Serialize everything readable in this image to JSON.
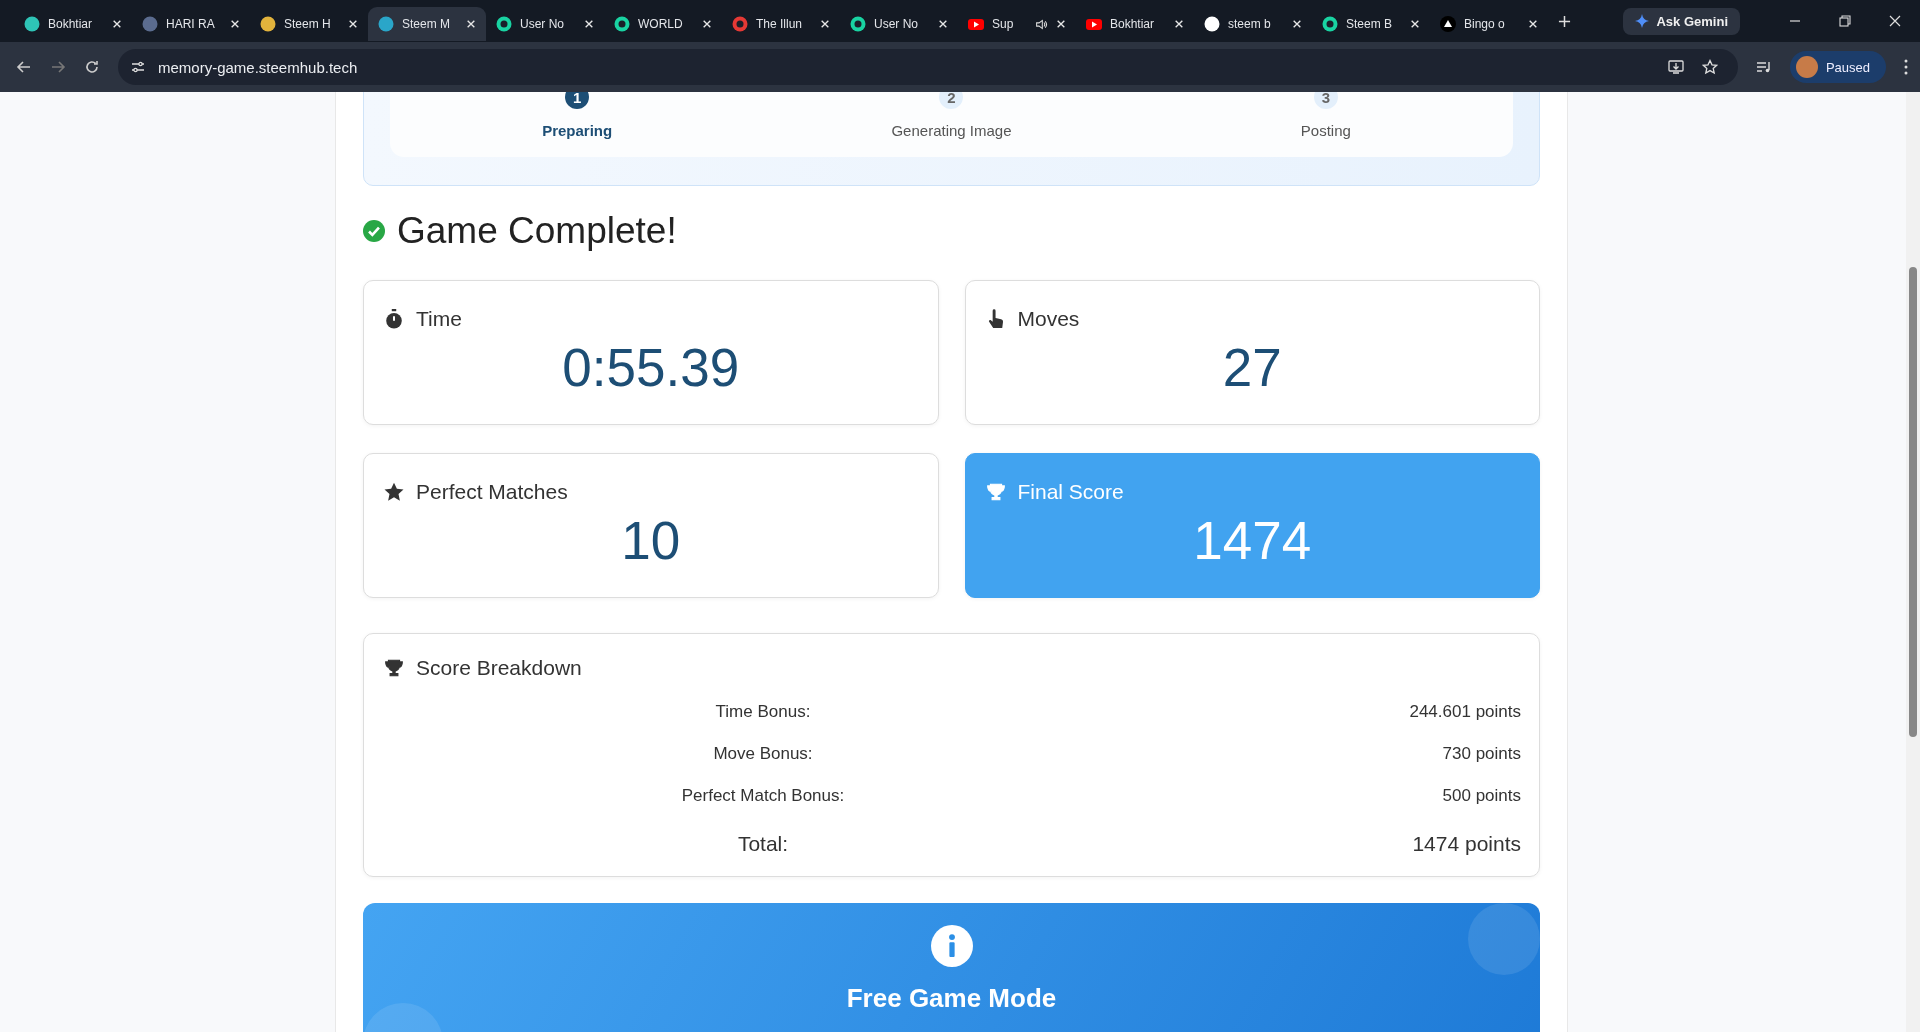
{
  "browser": {
    "tabs": [
      {
        "title": "Bokhtiar",
        "kind": "steem",
        "selected": false,
        "audio": false
      },
      {
        "title": "HARI RA",
        "kind": "avatar",
        "selected": false,
        "audio": false
      },
      {
        "title": "Steem H",
        "kind": "coin",
        "selected": false,
        "audio": false
      },
      {
        "title": "Steem M",
        "kind": "globe",
        "selected": true,
        "audio": false
      },
      {
        "title": "User No",
        "kind": "chat",
        "selected": false,
        "audio": false
      },
      {
        "title": "WORLD",
        "kind": "chat",
        "selected": false,
        "audio": false
      },
      {
        "title": "The Illun",
        "kind": "pin",
        "selected": false,
        "audio": false
      },
      {
        "title": "User No",
        "kind": "chat",
        "selected": false,
        "audio": false
      },
      {
        "title": "Sup",
        "kind": "video",
        "selected": false,
        "audio": true
      },
      {
        "title": "Bokhtiar",
        "kind": "video",
        "selected": false,
        "audio": false
      },
      {
        "title": "steem b",
        "kind": "search",
        "selected": false,
        "audio": false
      },
      {
        "title": "Steem B",
        "kind": "chat",
        "selected": false,
        "audio": false
      },
      {
        "title": "Bingo o",
        "kind": "triangle",
        "selected": false,
        "audio": false
      }
    ],
    "ask_button": "Ask Gemini",
    "url": "memory-game.steemhub.tech",
    "profile": "Paused"
  },
  "stepper": {
    "steps": [
      {
        "number": "1",
        "label": "Preparing",
        "selected": true
      },
      {
        "number": "2",
        "label": "Generating Image",
        "selected": false
      },
      {
        "number": "3",
        "label": "Posting",
        "selected": false
      }
    ]
  },
  "heading": "Game Complete!",
  "stats": [
    {
      "kind": "time",
      "label": "Time",
      "value": "0:55.39",
      "highlighted": false
    },
    {
      "kind": "moves",
      "label": "Moves",
      "value": "27",
      "highlighted": false
    },
    {
      "kind": "star",
      "label": "Perfect Matches",
      "value": "10",
      "highlighted": false
    },
    {
      "kind": "trophy",
      "label": "Final Score",
      "value": "1474",
      "highlighted": true
    }
  ],
  "breakdown": {
    "title": "Score Breakdown",
    "rows": [
      {
        "kind": "item",
        "label": "Time Bonus:",
        "value": "244.601 points"
      },
      {
        "kind": "item",
        "label": "Move Bonus:",
        "value": "730 points"
      },
      {
        "kind": "item",
        "label": "Perfect Match Bonus:",
        "value": "500 points"
      },
      {
        "kind": "total",
        "label": "Total:",
        "value": "1474 points"
      }
    ]
  },
  "notice": {
    "title": "Free Game Mode"
  }
}
